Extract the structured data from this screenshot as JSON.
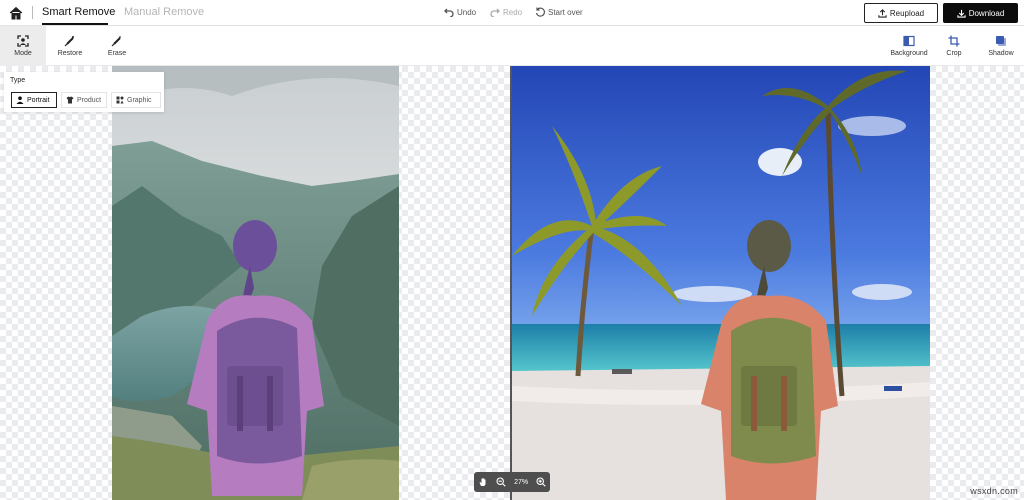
{
  "header": {
    "tabs": [
      {
        "label": "Smart Remove",
        "active": true
      },
      {
        "label": "Manual Remove",
        "active": false
      }
    ],
    "history": {
      "undo": "Undo",
      "redo": "Redo",
      "start_over": "Start over"
    },
    "reupload": "Reupload",
    "download": "Download"
  },
  "toolbar": {
    "left": [
      {
        "label": "Mode",
        "icon": "portrait-frame-icon",
        "active": true
      },
      {
        "label": "Restore",
        "icon": "restore-brush-icon"
      },
      {
        "label": "Erase",
        "icon": "erase-brush-icon"
      }
    ],
    "right": [
      {
        "label": "Background",
        "icon": "background-icon"
      },
      {
        "label": "Crop",
        "icon": "crop-icon"
      },
      {
        "label": "Shadow",
        "icon": "shadow-icon"
      }
    ]
  },
  "type_panel": {
    "title": "Type",
    "options": [
      {
        "label": "Portrait",
        "icon": "person-icon",
        "selected": true
      },
      {
        "label": "Product",
        "icon": "shirt-icon",
        "selected": false
      },
      {
        "label": "Graphic",
        "icon": "shapes-icon",
        "selected": false
      }
    ]
  },
  "zoom": {
    "value": "27%"
  },
  "watermark": "wsxdn.com",
  "colors": {
    "accent": "#0c0c0c",
    "tab_inactive": "#b5b5b5",
    "checker": "#e9ebee"
  }
}
